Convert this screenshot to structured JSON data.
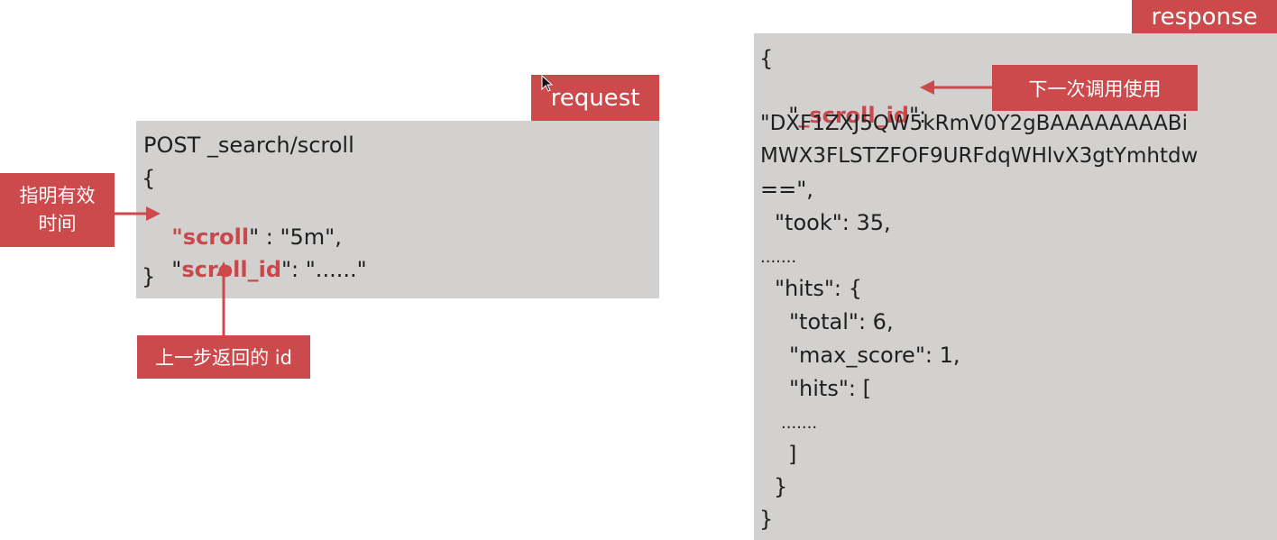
{
  "request": {
    "tag_label": "request",
    "line_post": "POST _search/scroll",
    "brace_open": "{",
    "scroll_q1": "\"",
    "scroll_key": "scroll",
    "scroll_rest": "\" : \"5m\",",
    "scrollid_q1": "\"",
    "scrollid_key": "scroll_id",
    "scrollid_rest": "\": \"......\"",
    "brace_close": "}"
  },
  "annotations": {
    "valid_time_line1": "指明有效",
    "valid_time_line2": "时间",
    "previous_id": "上一步返回的 id",
    "next_call": "下一次调用使用"
  },
  "response": {
    "tag_label": "response",
    "brace_open": "{",
    "scrollid_q1": "\"",
    "scrollid_key": "_scroll_id",
    "scrollid_rest": "\":",
    "value_line1": "\"DXF1ZXJ5QW5kRmV0Y2gBAAAAAAAABi",
    "value_line2": "MWX3FLSTZFOF9URFdqWHlvX3gtYmhtdw",
    "value_line3": "==\",",
    "took": "\"took\": 35,",
    "ellipsis1": ".......",
    "hits_open": "\"hits\": {",
    "total": "\"total\": 6,",
    "max_score": "\"max_score\": 1,",
    "inner_hits": "\"hits\": [",
    "ellipsis2": ".......",
    "bracket_close": "]",
    "hits_close": "}",
    "brace_close": "}"
  }
}
